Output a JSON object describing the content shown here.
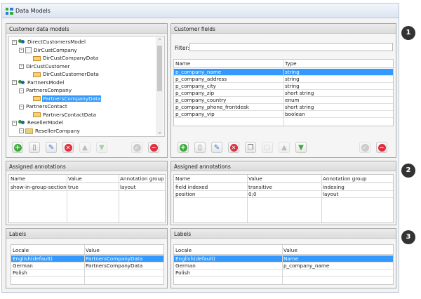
{
  "window": {
    "title": "Data Models"
  },
  "customer_models": {
    "header": "Customer data models",
    "tree": [
      {
        "label": "DirectCustomersModel",
        "icon": "model-icon",
        "indent": 0,
        "expander": "-"
      },
      {
        "label": "DirCustCompany",
        "icon": "entity-icon",
        "indent": 1,
        "expander": "-"
      },
      {
        "label": "DirCustCompanyData",
        "icon": "data-icon",
        "indent": 2,
        "expander": ""
      },
      {
        "label": "DirCustCustomer",
        "icon": "",
        "indent": 1,
        "expander": "-"
      },
      {
        "label": "DirCustCustomerData",
        "icon": "data-icon",
        "indent": 2,
        "expander": ""
      },
      {
        "label": "PartnersModel",
        "icon": "model-icon",
        "indent": 0,
        "expander": "-"
      },
      {
        "label": "PartnersCompany",
        "icon": "",
        "indent": 1,
        "expander": "-"
      },
      {
        "label": "PartnersCompanyData",
        "icon": "data-icon",
        "indent": 2,
        "expander": "",
        "selected": true
      },
      {
        "label": "PartnersContact",
        "icon": "",
        "indent": 1,
        "expander": "-"
      },
      {
        "label": "PartnersContactData",
        "icon": "data-icon",
        "indent": 2,
        "expander": ""
      },
      {
        "label": "ResellerModel",
        "icon": "model-icon",
        "indent": 0,
        "expander": "-"
      },
      {
        "label": "ResellerCompany",
        "icon": "folder-icon",
        "indent": 1,
        "expander": "-"
      }
    ]
  },
  "customer_fields": {
    "header": "Customer fields",
    "filter_label": "Filter:",
    "filter_value": "",
    "columns": [
      "Name",
      "Type"
    ],
    "rows": [
      {
        "name": "p_company_name",
        "type": "string",
        "selected": true
      },
      {
        "name": "p_company_address",
        "type": "string"
      },
      {
        "name": "p_company_city",
        "type": "string"
      },
      {
        "name": "p_company_zip",
        "type": "short string"
      },
      {
        "name": "p_company_country",
        "type": "enum"
      },
      {
        "name": "p_company_phone_frontdesk",
        "type": "short string"
      },
      {
        "name": "p_company_vip",
        "type": "boolean"
      }
    ]
  },
  "annotations_left": {
    "header": "Assigned annotations",
    "columns": [
      "Name",
      "Value",
      "Annotation group"
    ],
    "rows": [
      {
        "name": "show-in-group-section",
        "value": "true",
        "group": "layout"
      }
    ]
  },
  "annotations_right": {
    "header": "Assigned annotations",
    "columns": [
      "Name",
      "Value",
      "Annotation group"
    ],
    "rows": [
      {
        "name": "field indexed",
        "value": "transitive",
        "group": "indexing"
      },
      {
        "name": "position",
        "value": "0;0",
        "group": "layout"
      }
    ]
  },
  "labels_left": {
    "header": "Labels",
    "columns": [
      "Locale",
      "Value"
    ],
    "rows": [
      {
        "locale": "English(default)",
        "value": "PartnersCompanyData",
        "selected": true
      },
      {
        "locale": "German",
        "value": "PartnersCompanyData"
      },
      {
        "locale": "Polish",
        "value": ""
      }
    ]
  },
  "labels_right": {
    "header": "Labels",
    "columns": [
      "Locale",
      "Value"
    ],
    "rows": [
      {
        "locale": "English(default)",
        "value": "Name",
        "selected": true
      },
      {
        "locale": "German",
        "value": "p_company_name"
      },
      {
        "locale": "Polish",
        "value": ""
      }
    ]
  },
  "callouts": [
    "1",
    "2",
    "3"
  ],
  "toolbar_left": [
    {
      "name": "add-button",
      "icon": "plus-icon"
    },
    {
      "name": "new-document-button",
      "icon": "document-icon"
    },
    {
      "name": "edit-button",
      "icon": "edit-icon"
    },
    {
      "name": "delete-button",
      "icon": "x-icon"
    },
    {
      "name": "move-up-button",
      "icon": "arrow-up-icon",
      "disabled": true
    },
    {
      "name": "move-down-button",
      "icon": "arrow-down-icon",
      "disabled": true
    },
    {
      "name": "confirm-button",
      "icon": "check-icon",
      "disabled": true
    },
    {
      "name": "remove-button",
      "icon": "minus-icon"
    }
  ],
  "toolbar_right": [
    {
      "name": "add-field-button",
      "icon": "plus-icon"
    },
    {
      "name": "new-field-document-button",
      "icon": "document-icon"
    },
    {
      "name": "edit-field-button",
      "icon": "edit-icon"
    },
    {
      "name": "delete-field-button",
      "icon": "x-icon"
    },
    {
      "name": "copy-field-button",
      "icon": "copy-icon"
    },
    {
      "name": "paste-field-button",
      "icon": "paste-icon",
      "disabled": true
    },
    {
      "name": "field-up-button",
      "icon": "arrow-up-icon",
      "disabled": true
    },
    {
      "name": "field-down-button",
      "icon": "arrow-down-icon"
    },
    {
      "name": "confirm-field-button",
      "icon": "check-icon",
      "disabled": true
    },
    {
      "name": "remove-field-button",
      "icon": "minus-icon"
    }
  ]
}
